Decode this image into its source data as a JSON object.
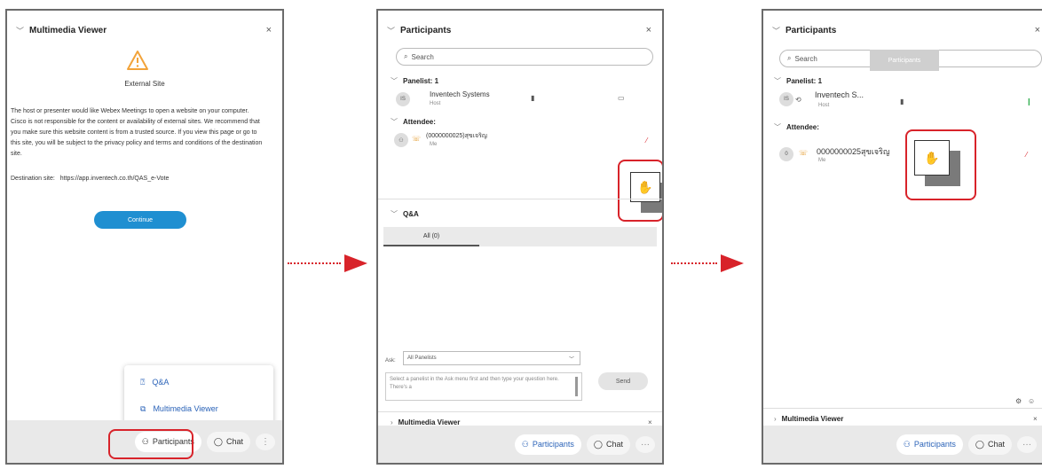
{
  "panel1": {
    "header": {
      "title": "Multimedia Viewer",
      "close": "×"
    },
    "warning_title": "External Site",
    "body_text": "The host or presenter would like Webex Meetings to open a website on your computer. Cisco is not responsible for the content or availability of external sites. We recommend that you make sure this website content is from a trusted source. If you view this page or go to this site, you will be subject to the privacy policy and terms and conditions of the destination site.",
    "destination_label": "Destination site:",
    "destination_url": "https://app.inventech.co.th/QAS_e-Vote",
    "continue_label": "Continue",
    "menu": [
      {
        "icon": "qa-icon",
        "label": "Q&A"
      },
      {
        "icon": "multimedia-viewer-icon",
        "label": "Multimedia Viewer"
      }
    ],
    "footer": {
      "participants": "Participants",
      "chat": "Chat",
      "more": "⋮"
    }
  },
  "panel2": {
    "header": {
      "title": "Participants",
      "close": "×"
    },
    "search_placeholder": "Search",
    "panelist_section": "Panelist: 1",
    "panelist_name": "Inventech Systems",
    "panelist_role": "Host",
    "attendee_section": "Attendee:",
    "attendee_name": "(0000000025)สุขเจริญ",
    "attendee_role": "Me",
    "qa_section": "Q&A",
    "qa_tab": "All (0)",
    "ask_label": "Ask:",
    "ask_select": "All Panelists",
    "question_placeholder": "Select a panelist in the Ask menu first and then type your question here. There's a",
    "send_label": "Send",
    "mm_section": "Multimedia Viewer",
    "footer": {
      "participants": "Participants",
      "chat": "Chat",
      "more": "···"
    }
  },
  "panel3": {
    "header": {
      "title": "Participants",
      "close": "×"
    },
    "search_placeholder": "Search",
    "tooltip": "Participants",
    "panelist_section": "Panelist: 1",
    "panelist_name": "Inventech S...",
    "panelist_role": "Host",
    "attendee_section": "Attendee:",
    "attendee_name": "0000000025สุขเจริญ",
    "attendee_role": "Me",
    "mm_section": "Multimedia Viewer",
    "footer": {
      "participants": "Participants",
      "chat": "Chat",
      "more": "···"
    }
  },
  "colors": {
    "highlight": "#d8232a",
    "accent_blue": "#2b63b8",
    "continue_blue": "#1f8fd1"
  }
}
